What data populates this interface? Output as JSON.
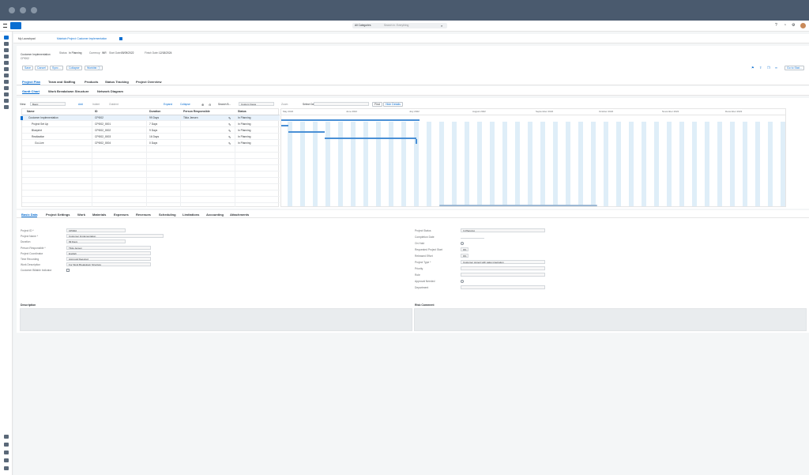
{
  "shell": {
    "search_scope": "All Categories",
    "search_placeholder": "Search in: Everything"
  },
  "breadcrumb": {
    "home": "My Launchpad",
    "title": "Maintain Project: Customer Implementation"
  },
  "header": {
    "object_title": "Customer Implementation",
    "object_id": "CPI002",
    "status_label": "Status:",
    "status_value": "In Planning",
    "currency_label": "Currency:",
    "currency_value": "INR",
    "start_label": "Start Date:",
    "start_value": "05/09/2022",
    "finish_label": "Finish Date:",
    "finish_value": "12/18/2024",
    "actions": [
      "Save",
      "Cancel",
      "Sync...",
      "Collapse",
      "Worklist ⓘ"
    ],
    "right_button": "Go to Stat..."
  },
  "tabs": [
    "Project Plan",
    "Team and Staffing",
    "Products",
    "Status Tracking",
    "Project Overview"
  ],
  "subtabs": [
    "Gantt Chart",
    "Work Breakdown Structure",
    "Network Diagram"
  ],
  "toolbar": {
    "view_label": "View:",
    "view_value": "Basic",
    "items": [
      "Add",
      "Indent",
      "Outdent",
      "Expand",
      "Collapse",
      "Search B...",
      "Custom Views"
    ],
    "zoom_label": "Zoom",
    "date_label": "Select Date",
    "find_label": "Find",
    "hide_button": "Hide Details"
  },
  "table": {
    "columns": [
      "Name",
      "ID",
      "Duration",
      "Person Responsible",
      "Status"
    ],
    "rows": [
      {
        "name": "Customer Implementation",
        "id": "CPI002",
        "duration": "99 Days",
        "person": "Tilda Jensen",
        "status": "In Planning"
      },
      {
        "name": "Project Set Up",
        "id": "CPI002_0001",
        "duration": "7 Days",
        "person": "",
        "status": "In Planning"
      },
      {
        "name": "Blueprint",
        "id": "CPI002_0002",
        "duration": "9 Days",
        "person": "",
        "status": "In Planning"
      },
      {
        "name": "Realization",
        "id": "CPI002_0003",
        "duration": "16 Days",
        "person": "",
        "status": "In Planning"
      },
      {
        "name": "Go-Live",
        "id": "CPI002_0004",
        "duration": "0 Days",
        "person": "",
        "status": "In Planning"
      }
    ]
  },
  "gantt": {
    "months": [
      "May 2022",
      "June 2022",
      "July 2022",
      "August 2022",
      "September 2022",
      "October 2022",
      "November 2022",
      "December 2022"
    ]
  },
  "detail_tabs": [
    "Basic Data",
    "Project Settings",
    "Work",
    "Materials",
    "Expenses",
    "Revenues",
    "Scheduling",
    "Limitations",
    "Accounting",
    "Attachments"
  ],
  "detail_left": [
    {
      "label": "Project ID *",
      "value": "CPI002"
    },
    {
      "label": "Project Name *",
      "value": "Customer Implementation"
    },
    {
      "label": "Duration",
      "value": "99 Days"
    },
    {
      "label": "Person Responsible *",
      "value": "Tilda Jensen"
    },
    {
      "label": "Project Coordinator",
      "value": "English"
    },
    {
      "label": "Time Recording",
      "value": "Approval Required"
    },
    {
      "label": "Work Description",
      "value": "For Work Breakdown Structure"
    },
    {
      "label": "Customer Billable Indicator",
      "value": ""
    }
  ],
  "detail_right": [
    {
      "label": "Project Status",
      "value": "In Planning"
    },
    {
      "label": "Completion Date",
      "value": ""
    },
    {
      "label": "On Hold",
      "value": ""
    },
    {
      "label": "Requested Project Start",
      "value": "0%"
    },
    {
      "label": "Released Effort",
      "value": "0%"
    },
    {
      "label": "Project Type *",
      "value": "Customer project with sales integration"
    },
    {
      "label": "Priority",
      "value": ""
    },
    {
      "label": "Role",
      "value": ""
    },
    {
      "label": "Approval Needed",
      "value": ""
    },
    {
      "label": "Department",
      "value": ""
    }
  ],
  "description_label": "Description",
  "comments_label": "Risk Comment",
  "colors": {
    "accent": "#0a6ed1",
    "titlebar": "#4a5a6e",
    "gantt_bar": "#4a90d6",
    "gantt_band": "#dfeef8"
  }
}
